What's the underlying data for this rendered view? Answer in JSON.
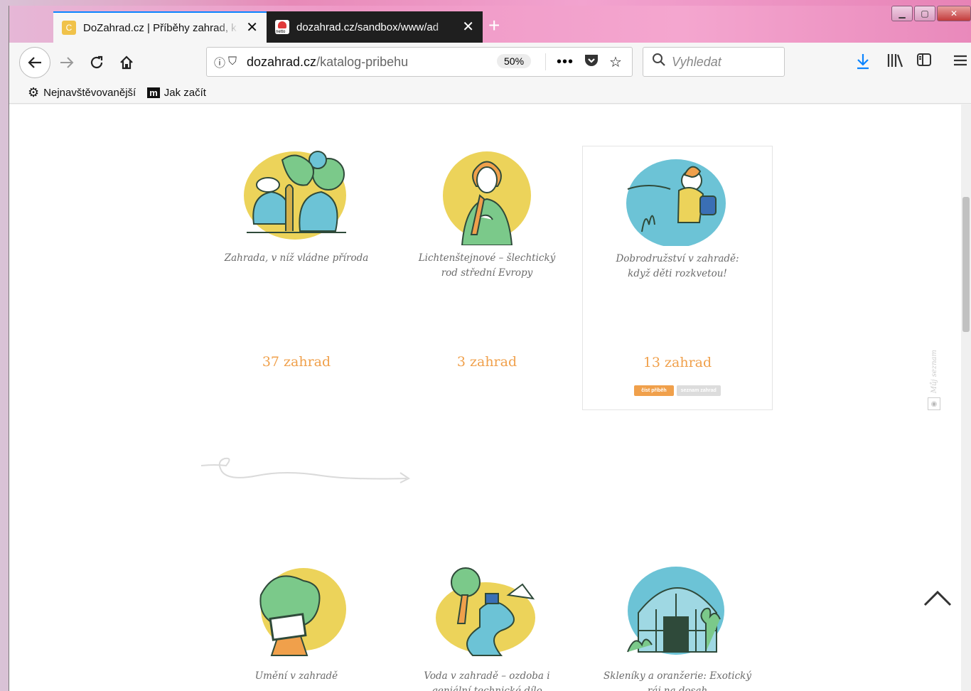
{
  "browser": {
    "tabs": [
      {
        "title": "DoZahrad.cz | Příběhy zahrad, k",
        "close": "✕"
      },
      {
        "title": "dozahrad.cz/sandbox/www/ad",
        "close": "✕"
      }
    ],
    "newtab": "+",
    "window_controls": {
      "minimize": "▁",
      "maximize": "▢",
      "close": "✕"
    },
    "url": {
      "host": "dozahrad.cz",
      "path": "/katalog-pribehu"
    },
    "zoom": "50%",
    "search_placeholder": "Vyhledat",
    "bookmarks": [
      {
        "label": "Nejnavštěvovanější"
      },
      {
        "label": "Jak začít",
        "badge": "m"
      }
    ]
  },
  "stories": [
    {
      "title": "Zahrada, v níž vládne příroda",
      "count": "37 zahrad"
    },
    {
      "title": "Lichtenštejnové – šlechtický rod střední Evropy",
      "count": "3 zahrad"
    },
    {
      "title": "Dobrodružství v zahradě: když děti rozkvetou!",
      "count": "13 zahrad",
      "actions": {
        "read": "číst příběh",
        "list": "seznam zahrad"
      }
    },
    {
      "title": "Umění v zahradě"
    },
    {
      "title": "Voda v zahradě – ozdoba i geniální technické dílo"
    },
    {
      "title": "Skleníky a oranžerie: Exotický ráj na dosah"
    }
  ],
  "side_panel": {
    "label": "Můj seznam"
  },
  "colors": {
    "accent": "#f0a04b",
    "yellow": "#ecd35a",
    "teal": "#6cc3d6",
    "green": "#7bc98a",
    "text": "#6a6a6a"
  }
}
